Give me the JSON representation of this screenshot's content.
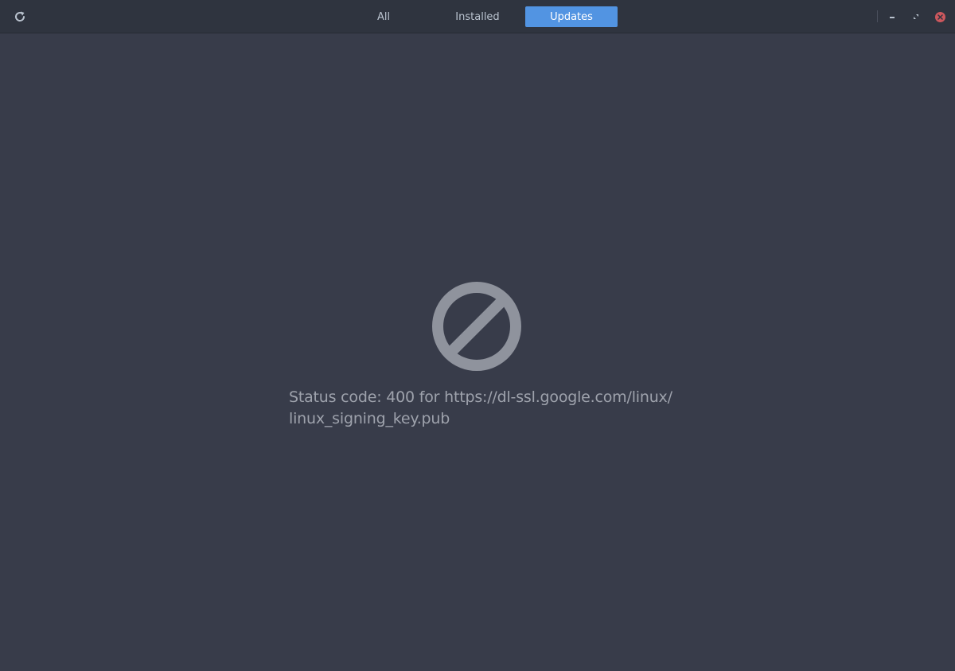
{
  "header": {
    "refresh_icon": "refresh-icon",
    "tabs": [
      {
        "label": "All",
        "active": false
      },
      {
        "label": "Installed",
        "active": false
      },
      {
        "label": "Updates",
        "active": true
      }
    ],
    "window_controls": [
      "minimize-icon",
      "maximize-icon",
      "close-icon"
    ]
  },
  "error": {
    "icon": "forbidden-icon",
    "message_line1": "Status code: 400 for https://dl-ssl.google.com/linux/",
    "message_line2": "linux_signing_key.pub"
  },
  "colors": {
    "background": "#383c4a",
    "headerbar": "#2f343f",
    "accent": "#5294e2",
    "close": "#cc575d",
    "icon_gray": "#8f939d"
  }
}
